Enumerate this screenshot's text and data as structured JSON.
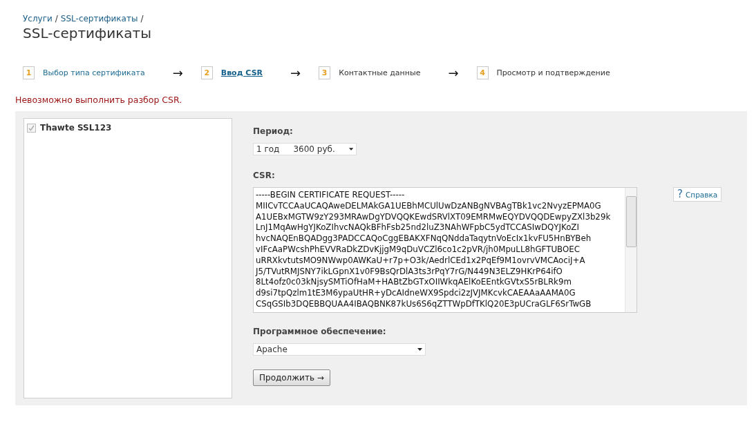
{
  "breadcrumb": [
    {
      "label": "Услуги",
      "separator": "/"
    },
    {
      "label": "SSL-сертификаты",
      "separator": "/"
    }
  ],
  "title": "SSL-сертификаты",
  "steps": [
    {
      "number": "1",
      "label": "Выбор типа сертификата",
      "completed": true,
      "selected": false
    },
    {
      "arrow": "→",
      "number": "2",
      "label": "Ввод CSR",
      "completed": false,
      "selected": true
    },
    {
      "arrow": "→",
      "number": "3",
      "label": "Контактные данные",
      "completed": false,
      "selected": false
    },
    {
      "arrow": "→",
      "number": "4",
      "label": "Просмотр и подтверждение",
      "completed": false,
      "selected": false
    }
  ],
  "error": "Невозможно выполнить разбор CSR.",
  "products": [
    {
      "label": "Thawte SSL123",
      "checked": true,
      "disabled": true
    }
  ],
  "period": {
    "label": "Период:",
    "term": "1 год",
    "price": "3600 руб."
  },
  "csr": {
    "label": "CSR:",
    "lines": [
      "-----BEGIN CERTIFICATE REQUEST-----",
      "MIICvTCCAaUCAQAweDELMAkGA1UEBhMCUlUwDzANBgNVBAgTBk1vc2NvyzEPMA0G",
      "A1UEBxMGTW9zY293MRAwDgYDVQQKEwdSRVlXT09EMRMwEQYDVQQDEwpyZXl3b29k",
      "LnJ1MqAwHgYJKoZIhvcNAQkBFhFsb25nd2luZ3NAhWFpbC5ydTCCASIwDQYJKoZI",
      "hvcNAQEnBQADgg3PADCCAQoCggEBAKXFNqQNddaTaqytnVoEcIx1kvFU5HnBYBeh",
      "vIFcAaPWcshPhEVVRaDkZDvKjjgM9qDuVCZl6co1c2pVR/jh0MpuLL8hGFTUBOEC",
      "uRRXkvtutsMO9NWwp0AWKaU+r7p+O3k/AedrlCEd1x2PqEf9M1ovrvVMCAociJ+A",
      "J5/TVutRMJSNY7ikLGpnX1v0F9BsQrDlA3ts3rPqY7rG/N449N3ELZ9HKrP64ifO",
      "8Lt4ofz0c03kNjsySMTiOfHaM+HABtZbGTxOIIWkqAElKoEEntkGVtxS5rBLRk9m",
      "d9si7tpQzlm1tE3M6ypaUtHR+yDcAIdneWX9Spdci2zJVJMKcvkCAEAAaAAMA0G",
      "CSqGSIb3DQEBBQUAA4IBAQBNK87kUs6S6qZTTWpDfTKlQ20E3pUCraGLF6SrTwGB"
    ]
  },
  "help": {
    "icon": "?",
    "label": "Справка"
  },
  "software": {
    "label": "Программное обеспечение:",
    "value": "Apache"
  },
  "submit": "Продолжить →"
}
